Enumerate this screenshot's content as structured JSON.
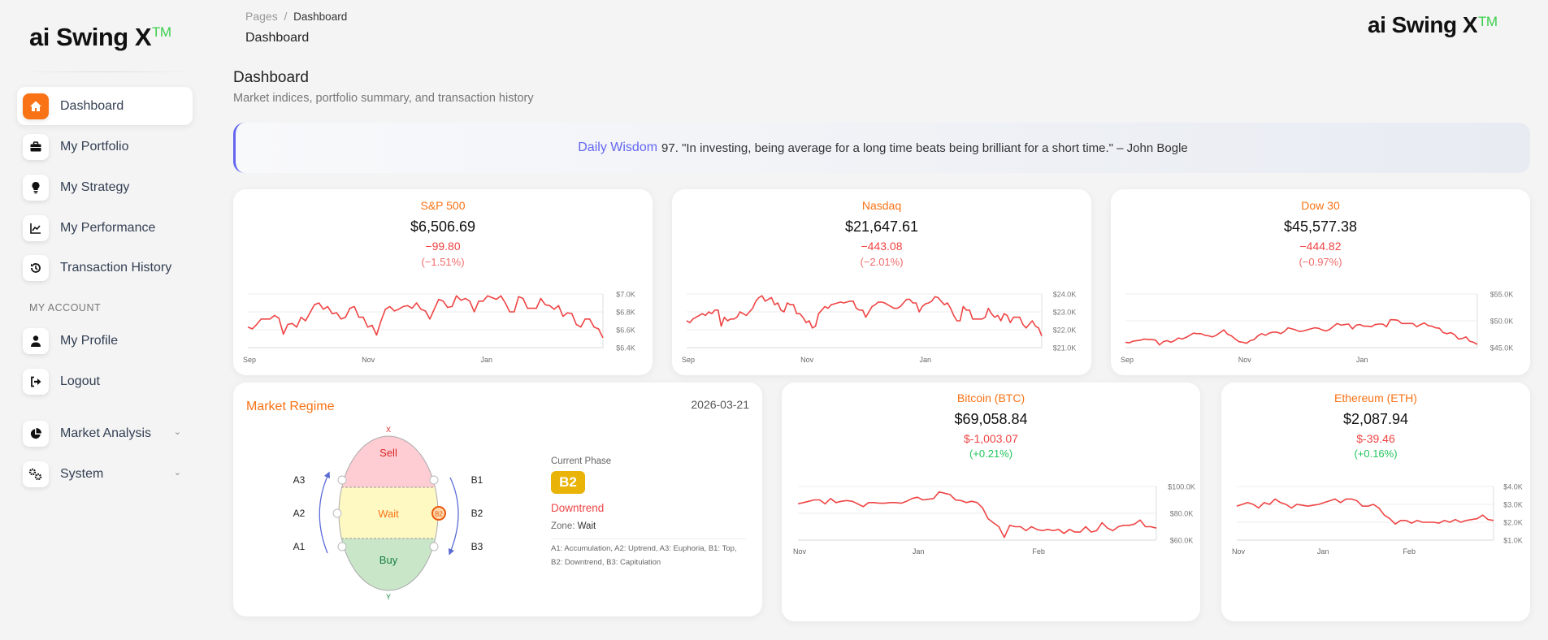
{
  "brand": {
    "name": "ai Swing X",
    "tm": "TM"
  },
  "sidebar": {
    "items": [
      {
        "label": "Dashboard",
        "icon": "home-icon",
        "active": true
      },
      {
        "label": "My Portfolio",
        "icon": "briefcase-icon"
      },
      {
        "label": "My Strategy",
        "icon": "lightbulb-icon"
      },
      {
        "label": "My Performance",
        "icon": "chart-line-icon"
      },
      {
        "label": "Transaction History",
        "icon": "history-icon"
      }
    ],
    "section": "MY ACCOUNT",
    "account_items": [
      {
        "label": "My Profile",
        "icon": "user-icon"
      },
      {
        "label": "Logout",
        "icon": "logout-icon"
      }
    ],
    "groups": [
      {
        "label": "Market Analysis",
        "icon": "pie-chart-icon"
      },
      {
        "label": "System",
        "icon": "gears-icon"
      }
    ]
  },
  "header": {
    "breadcrumb": [
      "Pages",
      "Dashboard"
    ],
    "title": "Dashboard"
  },
  "page": {
    "title": "Dashboard",
    "subtitle": "Market indices, portfolio summary, and transaction history"
  },
  "wisdom": {
    "label": "Daily Wisdom",
    "text": "97. \"In investing, being average for a long time beats being brilliant for a short time.\" – John Bogle"
  },
  "cards": [
    {
      "title": "S&P 500",
      "price": "$6,506.69",
      "change": "−99.80",
      "pct": "(−1.51%)",
      "pct_positive": false
    },
    {
      "title": "Nasdaq",
      "price": "$21,647.61",
      "change": "−443.08",
      "pct": "(−2.01%)",
      "pct_positive": false
    },
    {
      "title": "Dow 30",
      "price": "$45,577.38",
      "change": "−444.82",
      "pct": "(−0.97%)",
      "pct_positive": false
    },
    {
      "title": "Bitcoin (BTC)",
      "price": "$69,058.84",
      "change": "$-1,003.07",
      "pct": "(+0.21%)",
      "pct_positive": true
    },
    {
      "title": "Ethereum (ETH)",
      "price": "$2,087.94",
      "change": "$-39.46",
      "pct": "(+0.16%)",
      "pct_positive": true
    }
  ],
  "regime": {
    "title": "Market Regime",
    "date": "2026-03-21",
    "zones": {
      "sell": "Sell",
      "wait": "Wait",
      "buy": "Buy"
    },
    "axis": {
      "top": "X",
      "bottom": "Y"
    },
    "left_labels": [
      "A3",
      "A2",
      "A1"
    ],
    "right_labels": [
      "B1",
      "B2",
      "B3"
    ],
    "marker": "B2",
    "current_phase_label": "Current Phase",
    "phase": "B2",
    "phase_name": "Downtrend",
    "zone_label": "Zone:",
    "zone": "Wait",
    "legend_line1": "A1: Accumulation, A2: Uptrend, A3: Euphoria, B1: Top,",
    "legend_line2": "B2: Downtrend, B3: Capitulation",
    "colors": {
      "sell": "#fecdd3",
      "wait": "#fef9c3",
      "buy": "#c9e6c9",
      "badge": "#eab308",
      "downtrend": "#ef4444",
      "marker": "#ea580c"
    }
  },
  "chart_data": [
    {
      "type": "line",
      "name": "S&P 500",
      "color": "#ef4444",
      "x_domain_days": [
        0,
        180
      ],
      "x_ticks": [
        {
          "label": "Sep",
          "day": 0
        },
        {
          "label": "Nov",
          "day": 61
        },
        {
          "label": "Jan",
          "day": 121
        }
      ],
      "y_ticks": [
        {
          "label": "$7.0K",
          "value": 7.0
        },
        {
          "label": "$6.8K",
          "value": 6.8
        },
        {
          "label": "$6.6K",
          "value": 6.6
        },
        {
          "label": "$6.4K",
          "value": 6.4
        }
      ],
      "ylim": [
        6.4,
        7.0
      ],
      "unit": "thousand USD",
      "values": [
        6.63,
        6.61,
        6.66,
        6.72,
        6.72,
        6.72,
        6.76,
        6.73,
        6.55,
        6.66,
        6.67,
        6.63,
        6.74,
        6.7,
        6.79,
        6.88,
        6.9,
        6.83,
        6.86,
        6.78,
        6.79,
        6.72,
        6.74,
        6.84,
        6.86,
        6.74,
        6.74,
        6.63,
        6.65,
        6.54,
        6.7,
        6.83,
        6.86,
        6.81,
        6.83,
        6.86,
        6.87,
        6.84,
        6.9,
        6.83,
        6.81,
        6.72,
        6.83,
        6.94,
        6.92,
        6.85,
        6.86,
        6.98,
        6.93,
        6.95,
        6.92,
        6.8,
        6.92,
        6.92,
        6.98,
        6.96,
        6.94,
        6.98,
        6.9,
        6.8,
        6.8,
        6.97,
        6.95,
        6.84,
        6.84,
        6.84,
        6.95,
        6.88,
        6.87,
        6.83,
        6.87,
        6.75,
        6.79,
        6.78,
        6.66,
        6.63,
        6.72,
        6.72,
        6.63,
        6.61,
        6.51
      ]
    },
    {
      "type": "line",
      "name": "Nasdaq",
      "color": "#ef4444",
      "x_domain_days": [
        0,
        180
      ],
      "x_ticks": [
        {
          "label": "Sep",
          "day": 0
        },
        {
          "label": "Nov",
          "day": 61
        },
        {
          "label": "Jan",
          "day": 121
        }
      ],
      "y_ticks": [
        {
          "label": "$24.0K",
          "value": 24
        },
        {
          "label": "$23.0K",
          "value": 23
        },
        {
          "label": "$22.0K",
          "value": 22
        },
        {
          "label": "$21.0K",
          "value": 21
        }
      ],
      "ylim": [
        21,
        24
      ],
      "unit": "thousand USD",
      "values": [
        22.5,
        22.4,
        22.6,
        22.7,
        22.8,
        22.9,
        22.8,
        23.0,
        22.9,
        23.1,
        23.1,
        22.2,
        22.7,
        22.5,
        22.6,
        22.6,
        22.7,
        23.0,
        22.9,
        22.8,
        23.0,
        23.2,
        23.6,
        23.8,
        23.9,
        23.6,
        23.7,
        23.8,
        23.4,
        23.5,
        23.1,
        23.0,
        23.5,
        23.4,
        23.4,
        22.9,
        22.9,
        22.7,
        22.4,
        22.5,
        22.1,
        22.2,
        22.9,
        23.1,
        23.3,
        23.2,
        23.4,
        23.45,
        23.5,
        23.55,
        23.5,
        23.55,
        23.6,
        23.6,
        23.2,
        23.1,
        23.1,
        22.7,
        23.0,
        23.3,
        23.4,
        23.55,
        23.55,
        23.5,
        23.4,
        23.3,
        23.2,
        23.2,
        23.3,
        23.5,
        23.7,
        23.7,
        23.5,
        23.5,
        23.0,
        23.3,
        23.45,
        23.5,
        23.6,
        23.85,
        23.8,
        23.6,
        23.4,
        23.5,
        23.2,
        22.8,
        22.5,
        22.5,
        23.3,
        23.1,
        23.1,
        22.6,
        22.6,
        22.6,
        22.6,
        22.7,
        23.2,
        22.9,
        22.7,
        22.8,
        22.5,
        22.9,
        22.8,
        22.4,
        22.7,
        22.7,
        22.7,
        22.3,
        22.1,
        22.3,
        22.5,
        22.2,
        22.1,
        21.65
      ]
    },
    {
      "type": "line",
      "name": "Dow 30",
      "color": "#ef4444",
      "x_domain_days": [
        0,
        180
      ],
      "x_ticks": [
        {
          "label": "Sep",
          "day": 0
        },
        {
          "label": "Nov",
          "day": 61
        },
        {
          "label": "Jan",
          "day": 121
        }
      ],
      "y_ticks": [
        {
          "label": "$55.0K",
          "value": 55
        },
        {
          "label": "$50.0K",
          "value": 50
        },
        {
          "label": "$45.0K",
          "value": 45
        }
      ],
      "ylim": [
        45,
        55
      ],
      "unit": "thousand USD",
      "values": [
        46.0,
        45.9,
        46.2,
        46.3,
        46.4,
        46.6,
        46.5,
        46.5,
        46.4,
        45.5,
        46.1,
        46.3,
        46.0,
        46.3,
        46.8,
        46.6,
        46.9,
        47.3,
        47.7,
        47.6,
        47.6,
        47.3,
        47.2,
        47.0,
        47.3,
        47.8,
        48.3,
        47.5,
        47.2,
        46.6,
        46.1,
        46.0,
        45.8,
        46.3,
        46.5,
        47.2,
        47.6,
        47.3,
        47.7,
        47.9,
        47.9,
        47.6,
        48.0,
        48.7,
        48.5,
        48.3,
        48.0,
        48.1,
        48.3,
        48.5,
        48.7,
        48.6,
        48.3,
        48.1,
        48.4,
        49.0,
        49.5,
        49.2,
        49.3,
        49.4,
        48.5,
        49.2,
        49.3,
        49.0,
        49.0,
        48.9,
        49.3,
        49.4,
        49.4,
        48.9,
        50.2,
        50.2,
        50.1,
        49.5,
        49.5,
        49.5,
        49.5,
        48.9,
        49.3,
        49.6,
        49.1,
        49.0,
        48.7,
        48.6,
        47.8,
        47.6,
        47.8,
        47.4,
        46.6,
        46.7,
        47.0,
        46.2,
        46.0,
        45.6
      ]
    },
    {
      "type": "line",
      "name": "Bitcoin (BTC)",
      "color": "#ef4444",
      "x_domain_days": [
        0,
        137
      ],
      "x_ticks": [
        {
          "label": "Nov",
          "day": 0
        },
        {
          "label": "Jan",
          "day": 46
        },
        {
          "label": "Feb",
          "day": 92
        }
      ],
      "y_ticks": [
        {
          "label": "$100.0K",
          "value": 100
        },
        {
          "label": "$80.0K",
          "value": 80
        },
        {
          "label": "$60.0K",
          "value": 60
        }
      ],
      "ylim": [
        60,
        100
      ],
      "unit": "thousand USD",
      "values": [
        87,
        88,
        89,
        90,
        90,
        87,
        91,
        88,
        89,
        89.5,
        89,
        87,
        85,
        88,
        88,
        87.5,
        87.5,
        88,
        88,
        87.5,
        89,
        91,
        92,
        90,
        90.5,
        91,
        96,
        95,
        94,
        90,
        89.5,
        88,
        89,
        88,
        84,
        76,
        73,
        70,
        62,
        71,
        70,
        70,
        67,
        70,
        68,
        67,
        68,
        67,
        68,
        65,
        68,
        66,
        66,
        70,
        66,
        67,
        73,
        69,
        67,
        70,
        71,
        71,
        72,
        75,
        70,
        70,
        69
      ]
    },
    {
      "type": "line",
      "name": "Ethereum (ETH)",
      "color": "#ef4444",
      "x_domain_days": [
        0,
        137
      ],
      "x_ticks": [
        {
          "label": "Nov",
          "day": 0
        },
        {
          "label": "Jan",
          "day": 46
        },
        {
          "label": "Feb",
          "day": 92
        }
      ],
      "y_ticks": [
        {
          "label": "$4.0K",
          "value": 4
        },
        {
          "label": "$3.0K",
          "value": 3
        },
        {
          "label": "$2.0K",
          "value": 2
        },
        {
          "label": "$1.0K",
          "value": 1
        }
      ],
      "ylim": [
        1,
        4
      ],
      "unit": "thousand USD",
      "values": [
        2.9,
        3.0,
        3.1,
        3.0,
        2.8,
        3.1,
        3.0,
        3.3,
        3.1,
        3.0,
        2.8,
        3.0,
        2.95,
        2.9,
        2.95,
        3.0,
        3.1,
        3.2,
        3.3,
        3.1,
        3.3,
        3.3,
        3.2,
        2.9,
        2.9,
        3.0,
        2.8,
        2.4,
        2.2,
        1.9,
        2.1,
        2.1,
        1.95,
        2.1,
        2.0,
        2.0,
        2.0,
        1.95,
        2.1,
        2.0,
        2.15,
        2.0,
        2.1,
        2.15,
        2.2,
        2.4,
        2.15,
        2.1
      ]
    }
  ]
}
